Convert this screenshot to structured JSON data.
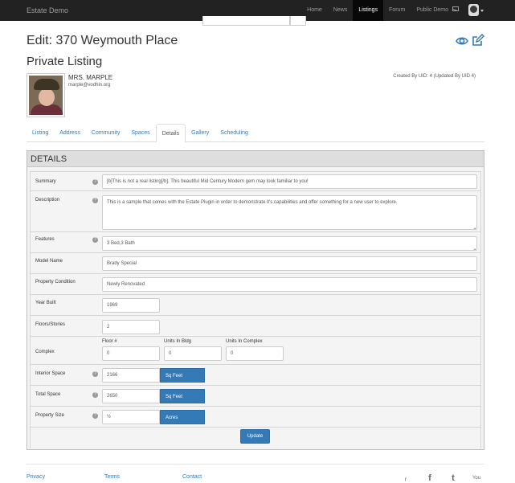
{
  "navbar": {
    "brand": "Estate Demo",
    "items": [
      {
        "label": "Home",
        "active": false
      },
      {
        "label": "News",
        "active": false
      },
      {
        "label": "Listings",
        "active": true
      },
      {
        "label": "Forum",
        "active": false
      },
      {
        "label": "Public Demo",
        "active": false
      }
    ]
  },
  "header": {
    "title": "Edit: 370 Weymouth Place",
    "subtitle": "Private Listing"
  },
  "owner": {
    "name": "MRS. MARPLE",
    "email": "marple@vodhin.org",
    "created_by": "Created By UID: 4 (Updated By UID 4)"
  },
  "tabs": [
    "Listing",
    "Address",
    "Community",
    "Spaces",
    "Details",
    "Gallery",
    "Scheduling"
  ],
  "active_tab": "Details",
  "panel": {
    "heading": "DETAILS",
    "summary": {
      "label": "Summary",
      "value": "[b]This is not a real listing[/b]. This beautiful Mid Century Modern gem may look familiar to you!"
    },
    "description": {
      "label": "Description",
      "value": "This is a sample that comes with the Estate Plugin in order to demonstrate it's capabilities and offer something for a new user to explore."
    },
    "features": {
      "label": "Features",
      "value": "3 Bed,3 Bath"
    },
    "model_name": {
      "label": "Model Name",
      "value": "Brady Special"
    },
    "property_condition": {
      "label": "Property Condition",
      "value": "Newly Renovated"
    },
    "year_built": {
      "label": "Year Built",
      "value": "1969"
    },
    "floors_stories": {
      "label": "Floors/Stories",
      "value": "2"
    },
    "complex": {
      "label": "Complex",
      "floor_label": "Floor #",
      "floor_value": "0",
      "units_bldg_label": "Units In Bldg",
      "units_bldg_value": "0",
      "units_complex_label": "Units In Complex",
      "units_complex_value": "0"
    },
    "interior_space": {
      "label": "Interior Space",
      "value": "2166",
      "unit": "Sq Feet"
    },
    "total_space": {
      "label": "Total Space",
      "value": "2650",
      "unit": "Sq Feet"
    },
    "property_size": {
      "label": "Property Size",
      "value": "½",
      "unit": "Acres"
    },
    "help_glyph": "?",
    "update_label": "Update"
  },
  "footer": {
    "links": [
      "Privacy",
      "Terms",
      "Contact"
    ],
    "social_icons": [
      "rss-icon",
      "facebook-icon",
      "twitter-icon",
      "youtube-icon"
    ],
    "social_glyphs": [
      "ᵣ",
      "f",
      "t",
      "You"
    ]
  },
  "colors": {
    "navbar": "#222222",
    "accent": "#337ab7"
  }
}
